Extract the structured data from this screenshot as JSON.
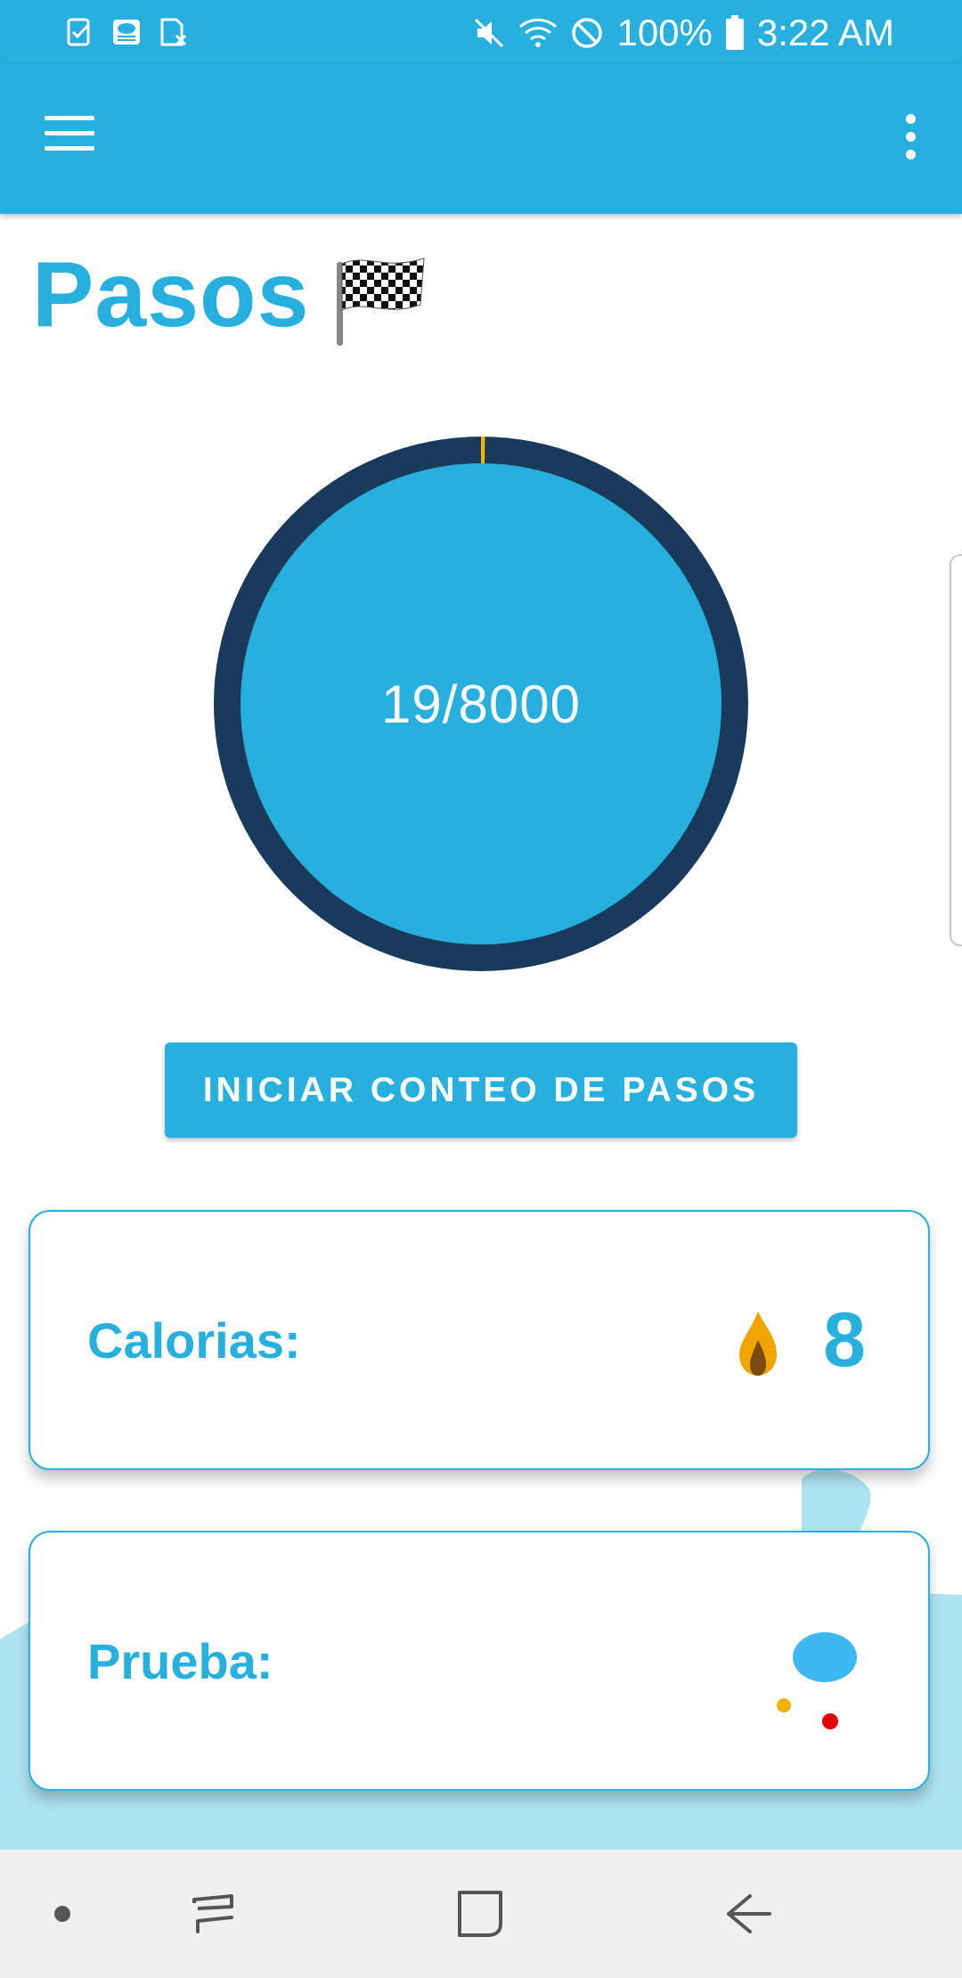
{
  "status_bar": {
    "icons_left": [
      "task-check-icon",
      "weather-test-icon",
      "sim-x-icon"
    ],
    "icons_right": [
      "mute-icon",
      "wifi-icon",
      "do-not-disturb-icon",
      "battery-icon"
    ],
    "battery": "100%",
    "time": "3:22 AM"
  },
  "app_bar": {
    "menu_icon": "hamburger-menu-icon",
    "overflow_icon": "more-vert-icon"
  },
  "page": {
    "title": "Pasos",
    "title_icon": "checkered-flag-icon"
  },
  "progress": {
    "steps": 19,
    "goal": 8000,
    "label": "19/8000",
    "fraction": 0.002375
  },
  "actions": {
    "start_label": "INICIAR CONTEO DE PASOS"
  },
  "cards": {
    "calories": {
      "label": "Calorias:",
      "icon": "flame-icon",
      "value": "8"
    },
    "test": {
      "label": "Prueba:",
      "icon": "drop-dots-icon"
    }
  },
  "nav_bar": {
    "items": [
      "dot-icon",
      "recents-icon",
      "home-icon",
      "back-icon"
    ]
  },
  "colors": {
    "primary": "#27b0dd",
    "ring_dark": "#1a3a5c",
    "accent": "#f0b400",
    "wave": "#aee3f1"
  }
}
